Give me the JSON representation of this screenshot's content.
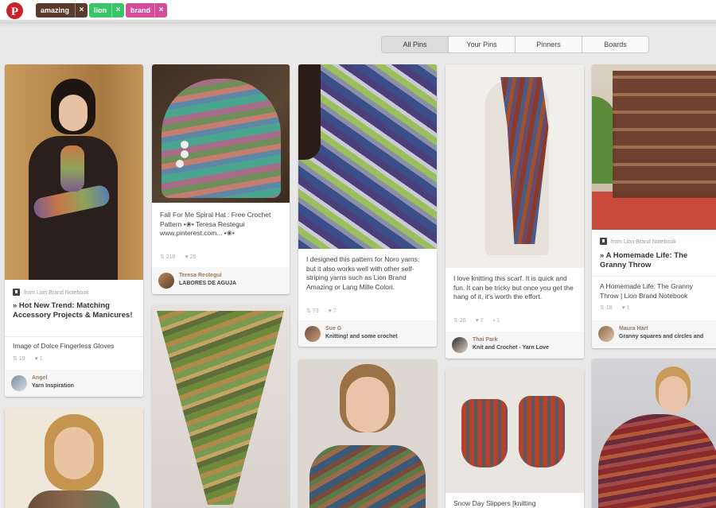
{
  "header": {
    "logo_icon": "pinterest-logo-icon",
    "tags": [
      {
        "label": "amazing",
        "color": "#5a3a2c"
      },
      {
        "label": "lion",
        "color": "#3bc56b"
      },
      {
        "label": "brand",
        "color": "#d34d9a"
      }
    ],
    "remove_symbol": "×"
  },
  "tabs": [
    "All Pins",
    "Your Pins",
    "Pinners",
    "Boards"
  ],
  "pins": {
    "gloves": {
      "source": "from Lion Brand Notebook",
      "title": "» Hot New Trend: Matching Accessory Projects & Manicures!",
      "desc": "Image of Dolce Fingerless Gloves",
      "repins": "19",
      "likes": "1",
      "user": "Angel",
      "board": "Yarn Inspiration"
    },
    "hat": {
      "desc": "Fall For Me Spiral Hat : Free Crochet Pattern •❀• Teresa Restegui www.pinterest.com... •❀•",
      "repins": "218",
      "likes": "25",
      "user": "Teresa Restegui",
      "board": "LABORES DE AGUJA"
    },
    "shawl_blue": {
      "desc": "I designed this pattern for Noro yarns, but it also works well with other self-striping yarns such as Lion Brand Amazing or Lang Mille Colori.",
      "repins": "73",
      "likes": "7",
      "user": "Sue G",
      "board": "Knitting! and some crochet"
    },
    "scarf": {
      "desc": "I love knitting this scarf. It is quick and fun. It can be tricky but once you get the hang of it, it's worth the effort.",
      "repins": "26",
      "likes": "2",
      "comments": "1",
      "user": "Thai Park",
      "board": "Knit and Crochet - Yarn Love"
    },
    "throw": {
      "source": "from Lion Brand Notebook",
      "title": "» A Homemade Life: The Granny Throw",
      "desc": "A Homemade Life: The Granny Throw | Lion Brand Notebook",
      "repins": "18",
      "likes": "1",
      "user": "Maura Hart",
      "board": "Granny squares and circles and"
    },
    "slippers": {
      "desc": "Snow Day Slippers [knitting"
    }
  }
}
